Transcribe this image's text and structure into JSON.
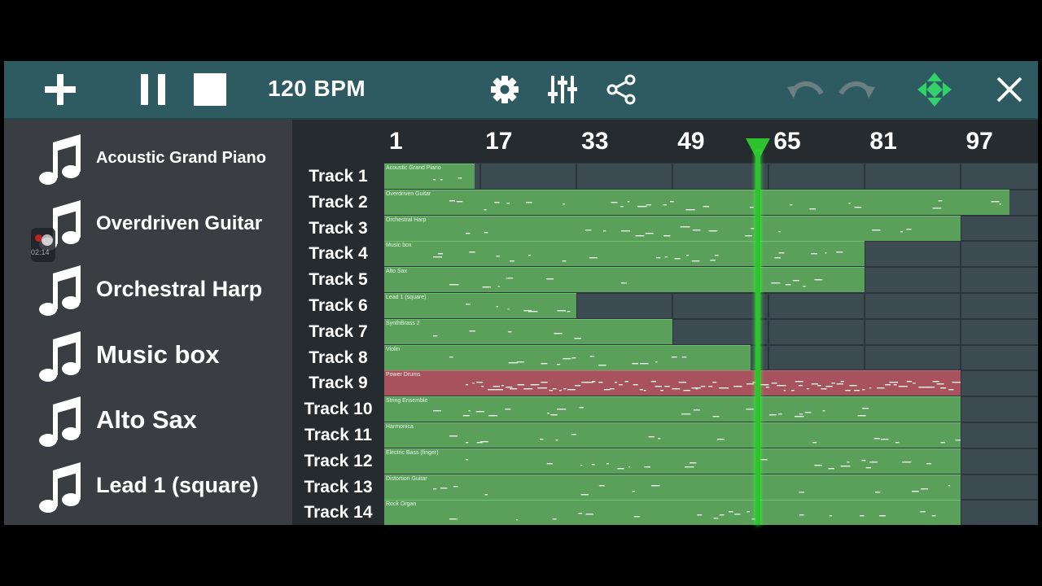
{
  "toolbar": {
    "bpm": "120 BPM",
    "icons": [
      "plus-icon",
      "pause-icon",
      "stop-icon",
      "gear-icon",
      "mixer-icon",
      "share-icon",
      "undo-icon",
      "redo-icon",
      "move-icon",
      "close-icon"
    ]
  },
  "instruments": [
    {
      "name": "Acoustic Grand Piano"
    },
    {
      "name": "Overdriven Guitar"
    },
    {
      "name": "Orchestral Harp"
    },
    {
      "name": "Music box"
    },
    {
      "name": "Alto Sax"
    },
    {
      "name": "Lead 1 (square)"
    }
  ],
  "ruler": {
    "bars": [
      "1",
      "17",
      "33",
      "49",
      "65",
      "81",
      "97"
    ]
  },
  "tracks": [
    {
      "label": "Track 1",
      "clip": "Acoustic Grand Piano",
      "start": 1,
      "end": 16,
      "drum": false
    },
    {
      "label": "Track 2",
      "clip": "Overdriven Guitar",
      "start": 1,
      "end": 105,
      "drum": false
    },
    {
      "label": "Track 3",
      "clip": "Orchestral Harp",
      "start": 1,
      "end": 97,
      "drum": false
    },
    {
      "label": "Track 4",
      "clip": "Music box",
      "start": 1,
      "end": 81,
      "drum": false
    },
    {
      "label": "Track 5",
      "clip": "Alto Sax",
      "start": 1,
      "end": 81,
      "drum": false
    },
    {
      "label": "Track 6",
      "clip": "Lead 1 (square)",
      "start": 1,
      "end": 33,
      "drum": false
    },
    {
      "label": "Track 7",
      "clip": "SynthBrass 2",
      "start": 1,
      "end": 49,
      "drum": false
    },
    {
      "label": "Track 8",
      "clip": "Violin",
      "start": 1,
      "end": 62,
      "drum": false
    },
    {
      "label": "Track 9",
      "clip": "Power Drums",
      "start": 1,
      "end": 97,
      "drum": true
    },
    {
      "label": "Track 10",
      "clip": "String Ensemble",
      "start": 1,
      "end": 97,
      "drum": false
    },
    {
      "label": "Track 11",
      "clip": "Harmonica",
      "start": 1,
      "end": 97,
      "drum": false
    },
    {
      "label": "Track 12",
      "clip": "Electric Bass (finger)",
      "start": 1,
      "end": 97,
      "drum": false
    },
    {
      "label": "Track 13",
      "clip": "Distortion Guitar",
      "start": 1,
      "end": 97,
      "drum": false
    },
    {
      "label": "Track 14",
      "clip": "Rock Organ",
      "start": 1,
      "end": 97,
      "drum": false
    }
  ],
  "playhead": {
    "bar": 62
  },
  "recording": {
    "time": "02:14"
  },
  "colors": {
    "toolbar": "#2e5a61",
    "clip": "#5aa05a",
    "drum_clip": "#a8525e",
    "playhead": "#2ec22e"
  }
}
